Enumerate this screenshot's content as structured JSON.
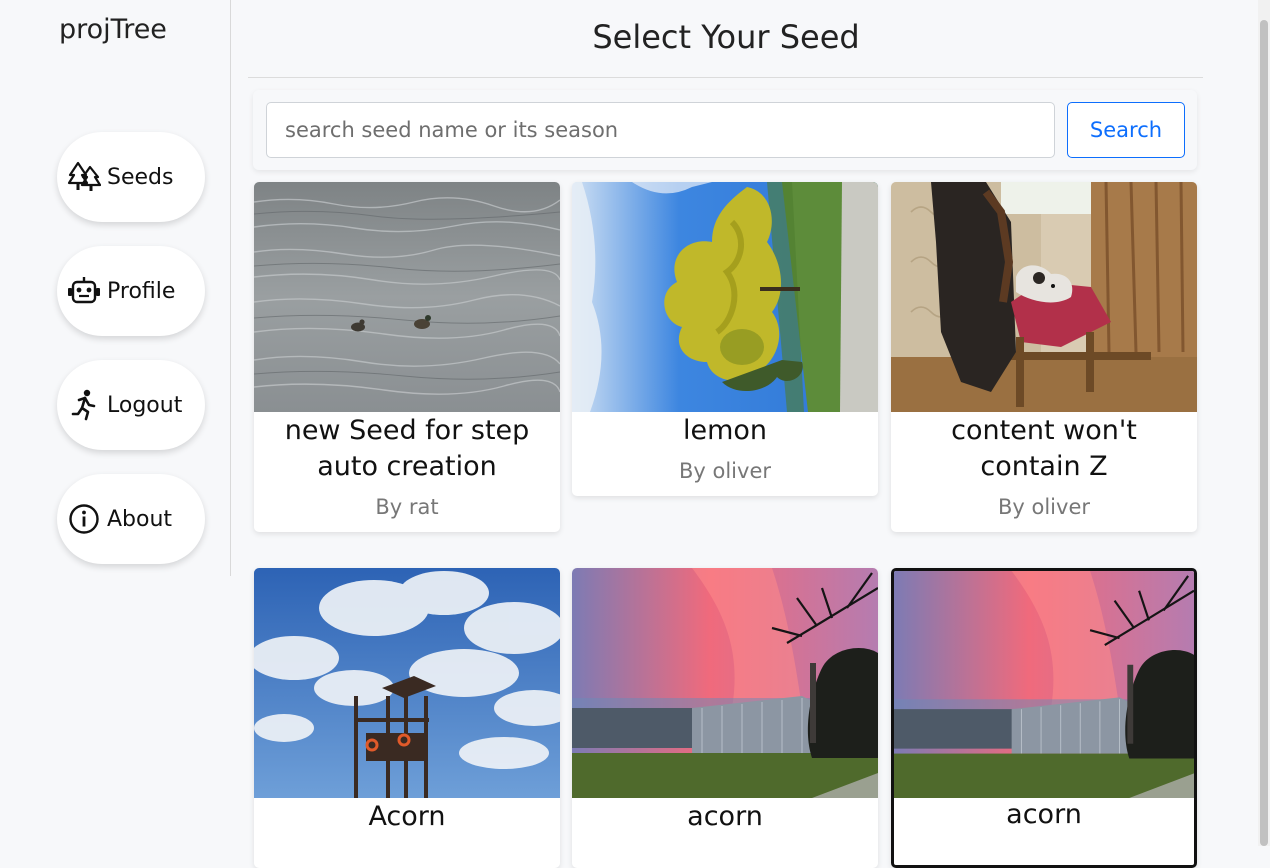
{
  "app": {
    "brand": "projTree"
  },
  "sidebar": {
    "items": [
      {
        "label": "Seeds",
        "icon": "trees-icon"
      },
      {
        "label": "Profile",
        "icon": "robot-icon"
      },
      {
        "label": "Logout",
        "icon": "running-person-icon"
      },
      {
        "label": "About",
        "icon": "info-circle-icon"
      }
    ]
  },
  "main": {
    "title": "Select Your Seed",
    "search": {
      "placeholder": "search seed name or its season",
      "value": "",
      "button_label": "Search"
    },
    "cards": [
      {
        "title": "new Seed for step auto creation",
        "author": "By rat",
        "image": "ducks on water"
      },
      {
        "title": "lemon",
        "author": "By oliver",
        "image": "yellow tree under blue sky"
      },
      {
        "title": "content won't contain Z",
        "author": "By oliver",
        "image": "dog on chair by window"
      },
      {
        "title": "Acorn",
        "author": "",
        "image": "lifeguard tower with clouds"
      },
      {
        "title": "acorn",
        "author": "",
        "image": "greenhouse at pink sunset"
      },
      {
        "title": "acorn",
        "author": "",
        "image": "greenhouse at pink sunset",
        "selected": true
      }
    ]
  },
  "colors": {
    "accent": "#0d6efd",
    "background": "#f7f8fa"
  }
}
